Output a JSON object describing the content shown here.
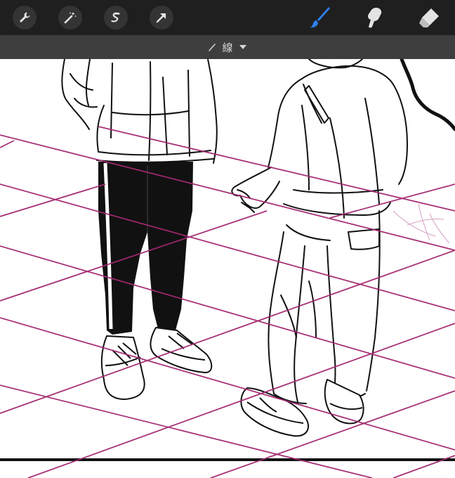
{
  "toolbar": {
    "left_tools": [
      "wrench-icon",
      "magic-wand-icon",
      "selection-s-icon",
      "transform-arrow-icon"
    ],
    "right_tools": [
      "brush-icon",
      "smudge-icon",
      "eraser-icon"
    ],
    "active_tool": "brush-icon",
    "accent_color": "#2f80ed"
  },
  "layer_bar": {
    "label": "線",
    "icon": "pencil-line-icon",
    "dropdown_icon": "triangle-down-icon"
  },
  "canvas": {
    "grid_color": "#a3286f",
    "ink_color": "#111111"
  }
}
